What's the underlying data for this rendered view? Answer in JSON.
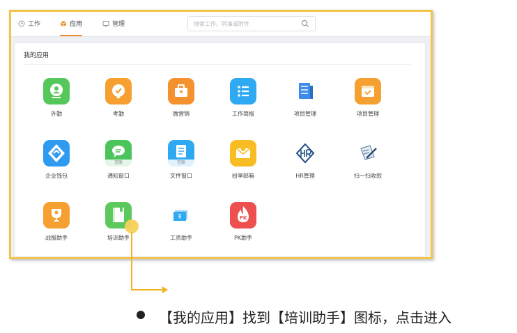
{
  "tabs": [
    {
      "label": "工作",
      "icon": "clock-icon"
    },
    {
      "label": "应用",
      "icon": "cube-icon",
      "active": true
    },
    {
      "label": "管理",
      "icon": "monitor-icon"
    }
  ],
  "search": {
    "placeholder": "搜索工作、同事或附件"
  },
  "panel": {
    "title": "我的应用"
  },
  "apps": [
    {
      "label": "外勤",
      "color": "#56c85b"
    },
    {
      "label": "考勤",
      "color": "#f5a030"
    },
    {
      "label": "微营销",
      "color": "#f5922f"
    },
    {
      "label": "工作简报",
      "color": "#2fa9f2"
    },
    {
      "label": "项目管理",
      "color": "#3b8ced"
    },
    {
      "label": "项目管理",
      "color": "#f5a030"
    },
    {
      "label": "企业钱包",
      "color": "#2f9bf0"
    },
    {
      "label": "通知窗口",
      "tag": "互联",
      "color": "#4cc45c"
    },
    {
      "label": "文件窗口",
      "tag": "互联",
      "color": "#2fa9f2"
    },
    {
      "label": "纷享邮箱",
      "color": "#f7bd23"
    },
    {
      "label": "HR管理",
      "color": "#1d4f86"
    },
    {
      "label": "扫一扫收款",
      "color": "#4a6f9b"
    },
    {
      "label": "战报助手",
      "color": "#f5a030"
    },
    {
      "label": "培训助手",
      "color": "#5cc95c"
    },
    {
      "label": "工资助手",
      "color": "#2fa9f2"
    },
    {
      "label": "PK助手",
      "color": "#ee4f4f"
    }
  ],
  "instruction": "【我的应用】找到【培训助手】图标，点击进入",
  "accent": "#f2c44a"
}
